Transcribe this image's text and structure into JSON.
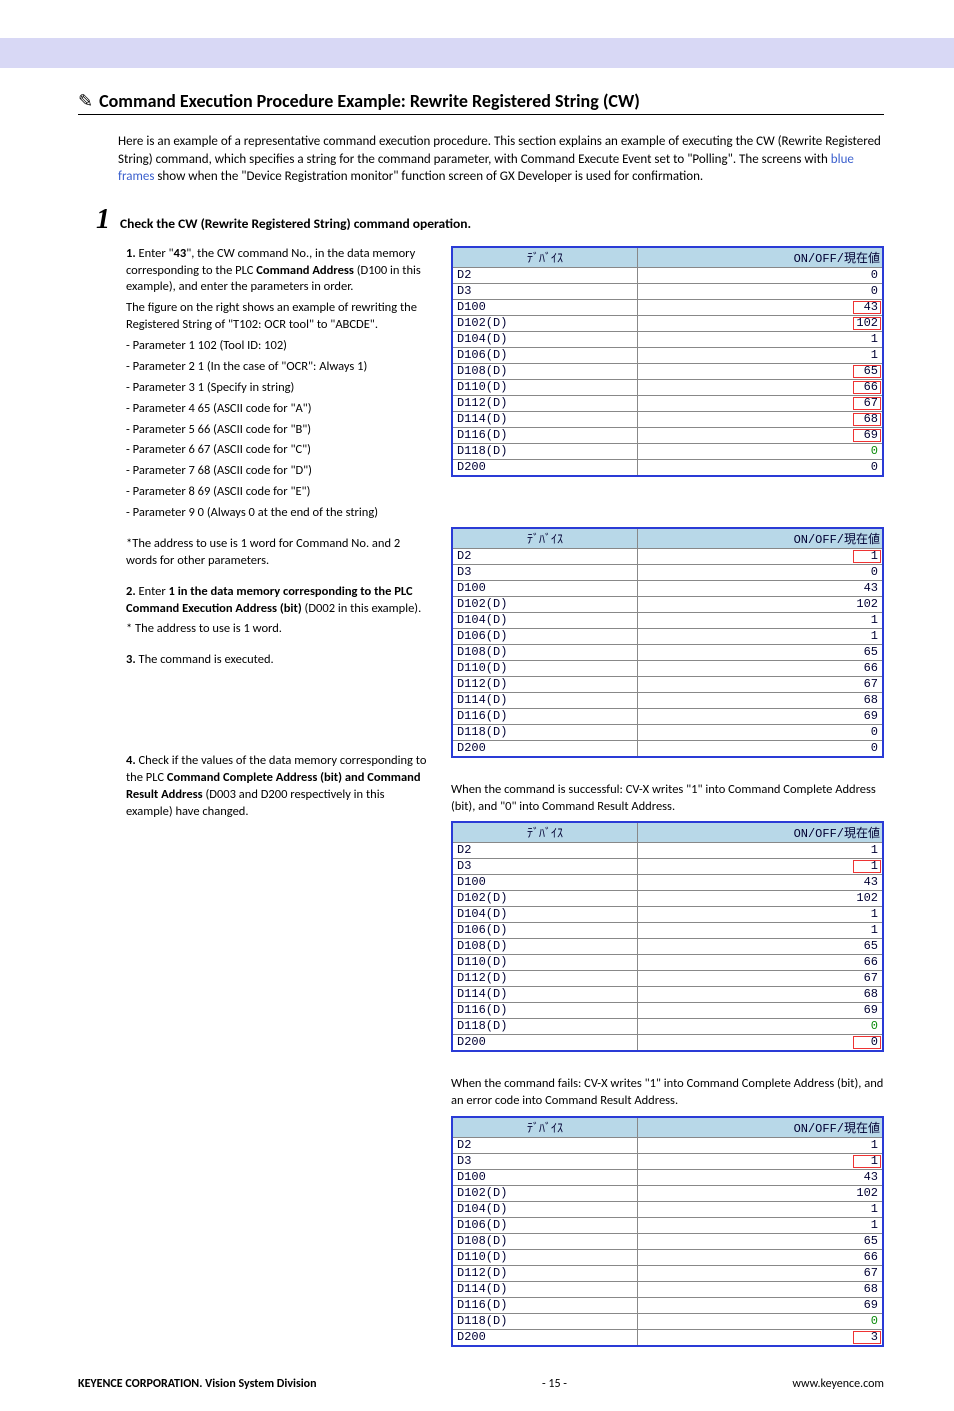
{
  "title": "Command Execution Procedure Example:  Rewrite Registered String (CW)",
  "intro_pre": "Here is an example of a representative command execution procedure. This section explains an example of executing the CW (Rewrite Registered String) command, which specifies a string for the command parameter, with Command Execute Event set to \"Polling\".  The screens with ",
  "intro_blue": "blue frames",
  "intro_post": " show when the \"Device Registration monitor\" function screen of GX Developer is used for confirmation.",
  "step_heading": "Check the CW (Rewrite Registered String) command operation.",
  "big1": "1",
  "left": {
    "p1a": "1.",
    "p1b": " Enter \"",
    "p1c": "43",
    "p1d": "\", the CW command No., in the data memory corresponding to the PLC ",
    "p1e": "Command Address",
    "p1f": " (D100 in this example), and enter the parameters in order.",
    "p2": "The figure on the right shows an example of rewriting the Registered String of \"T102: OCR tool\" to \"ABCDE\".",
    "params": [
      "- Parameter 1  102  (Tool ID: 102)",
      "- Parameter 2  1  (In the case of \"OCR\": Always 1)",
      "- Parameter 3  1  (Specify in string)",
      "- Parameter 4  65  (ASCII code for \"A\")",
      "- Parameter 5  66  (ASCII code for \"B\")",
      "- Parameter 6  67  (ASCII code for \"C\")",
      "- Parameter 7  68  (ASCII code for \"D\")",
      "- Parameter 8  69  (ASCII code for \"E\")",
      "- Parameter 9  0  (Always 0 at the end of the string)"
    ],
    "p3": "*The address to use is 1 word for Command No. and 2 words for other parameters.",
    "p4a": "2.",
    "p4b": " Enter ",
    "p4c": "1 in the data memory corresponding to the PLC Command Execution Address (bit)",
    "p4d": " (D002 in this example).",
    "p5": "* The address to use is 1 word.",
    "p6a": "3.",
    "p6b": " The command is executed.",
    "p7a": "4.",
    "p7b": " Check if the values of the data memory corresponding to the PLC ",
    "p7c": "Command Complete Address (bit) and Command Result Address",
    "p7d": " (D003 and D200 respectively in this example) have changed."
  },
  "headers": {
    "device": "ﾃﾞﾊﾞｲｽ",
    "value": "ON/OFF/現在値"
  },
  "table1": {
    "rows": [
      {
        "d": "D2",
        "v": "0"
      },
      {
        "d": "D3",
        "v": "0"
      },
      {
        "d": "D100",
        "v": "43",
        "hl": "red"
      },
      {
        "d": "D102(D)",
        "v": "102",
        "hl": "red"
      },
      {
        "d": "D104(D)",
        "v": "1"
      },
      {
        "d": "D106(D)",
        "v": "1"
      },
      {
        "d": "D108(D)",
        "v": "65",
        "hl": "red"
      },
      {
        "d": "D110(D)",
        "v": "66",
        "hl": "red"
      },
      {
        "d": "D112(D)",
        "v": "67",
        "hl": "red"
      },
      {
        "d": "D114(D)",
        "v": "68",
        "hl": "red"
      },
      {
        "d": "D116(D)",
        "v": "69",
        "hl": "red"
      },
      {
        "d": "D118(D)",
        "v": "0",
        "hl": "green"
      },
      {
        "d": "D200",
        "v": "0"
      }
    ]
  },
  "table2": {
    "rows": [
      {
        "d": "D2",
        "v": "1",
        "hl": "red"
      },
      {
        "d": "D3",
        "v": "0"
      },
      {
        "d": "D100",
        "v": "43"
      },
      {
        "d": "D102(D)",
        "v": "102"
      },
      {
        "d": "D104(D)",
        "v": "1"
      },
      {
        "d": "D106(D)",
        "v": "1"
      },
      {
        "d": "D108(D)",
        "v": "65"
      },
      {
        "d": "D110(D)",
        "v": "66"
      },
      {
        "d": "D112(D)",
        "v": "67"
      },
      {
        "d": "D114(D)",
        "v": "68"
      },
      {
        "d": "D116(D)",
        "v": "69"
      },
      {
        "d": "D118(D)",
        "v": "0"
      },
      {
        "d": "D200",
        "v": "0"
      }
    ]
  },
  "caption3": "When the command is successful: CV-X writes \"1\" into Command Complete Address (bit), and \"0\" into Command Result Address.",
  "table3": {
    "rows": [
      {
        "d": "D2",
        "v": "1"
      },
      {
        "d": "D3",
        "v": "1",
        "hl": "red"
      },
      {
        "d": "D100",
        "v": "43"
      },
      {
        "d": "D102(D)",
        "v": "102"
      },
      {
        "d": "D104(D)",
        "v": "1"
      },
      {
        "d": "D106(D)",
        "v": "1"
      },
      {
        "d": "D108(D)",
        "v": "65"
      },
      {
        "d": "D110(D)",
        "v": "66"
      },
      {
        "d": "D112(D)",
        "v": "67"
      },
      {
        "d": "D114(D)",
        "v": "68"
      },
      {
        "d": "D116(D)",
        "v": "69"
      },
      {
        "d": "D118(D)",
        "v": "0",
        "hl": "green"
      },
      {
        "d": "D200",
        "v": "0",
        "hl": "red"
      }
    ]
  },
  "caption4": "When the command fails: CV-X writes \"1\" into Command Complete Address (bit), and an error code into Command Result Address.",
  "table4": {
    "rows": [
      {
        "d": "D2",
        "v": "1"
      },
      {
        "d": "D3",
        "v": "1",
        "hl": "red"
      },
      {
        "d": "D100",
        "v": "43"
      },
      {
        "d": "D102(D)",
        "v": "102"
      },
      {
        "d": "D104(D)",
        "v": "1"
      },
      {
        "d": "D106(D)",
        "v": "1"
      },
      {
        "d": "D108(D)",
        "v": "65"
      },
      {
        "d": "D110(D)",
        "v": "66"
      },
      {
        "d": "D112(D)",
        "v": "67"
      },
      {
        "d": "D114(D)",
        "v": "68"
      },
      {
        "d": "D116(D)",
        "v": "69"
      },
      {
        "d": "D118(D)",
        "v": "0",
        "hl": "green"
      },
      {
        "d": "D200",
        "v": "3",
        "hl": "red"
      }
    ]
  },
  "footer": {
    "company_bold": "KEYENCE CORPORATION. Vision System Division",
    "page": "- 15 -",
    "url": "www.keyence.com"
  }
}
